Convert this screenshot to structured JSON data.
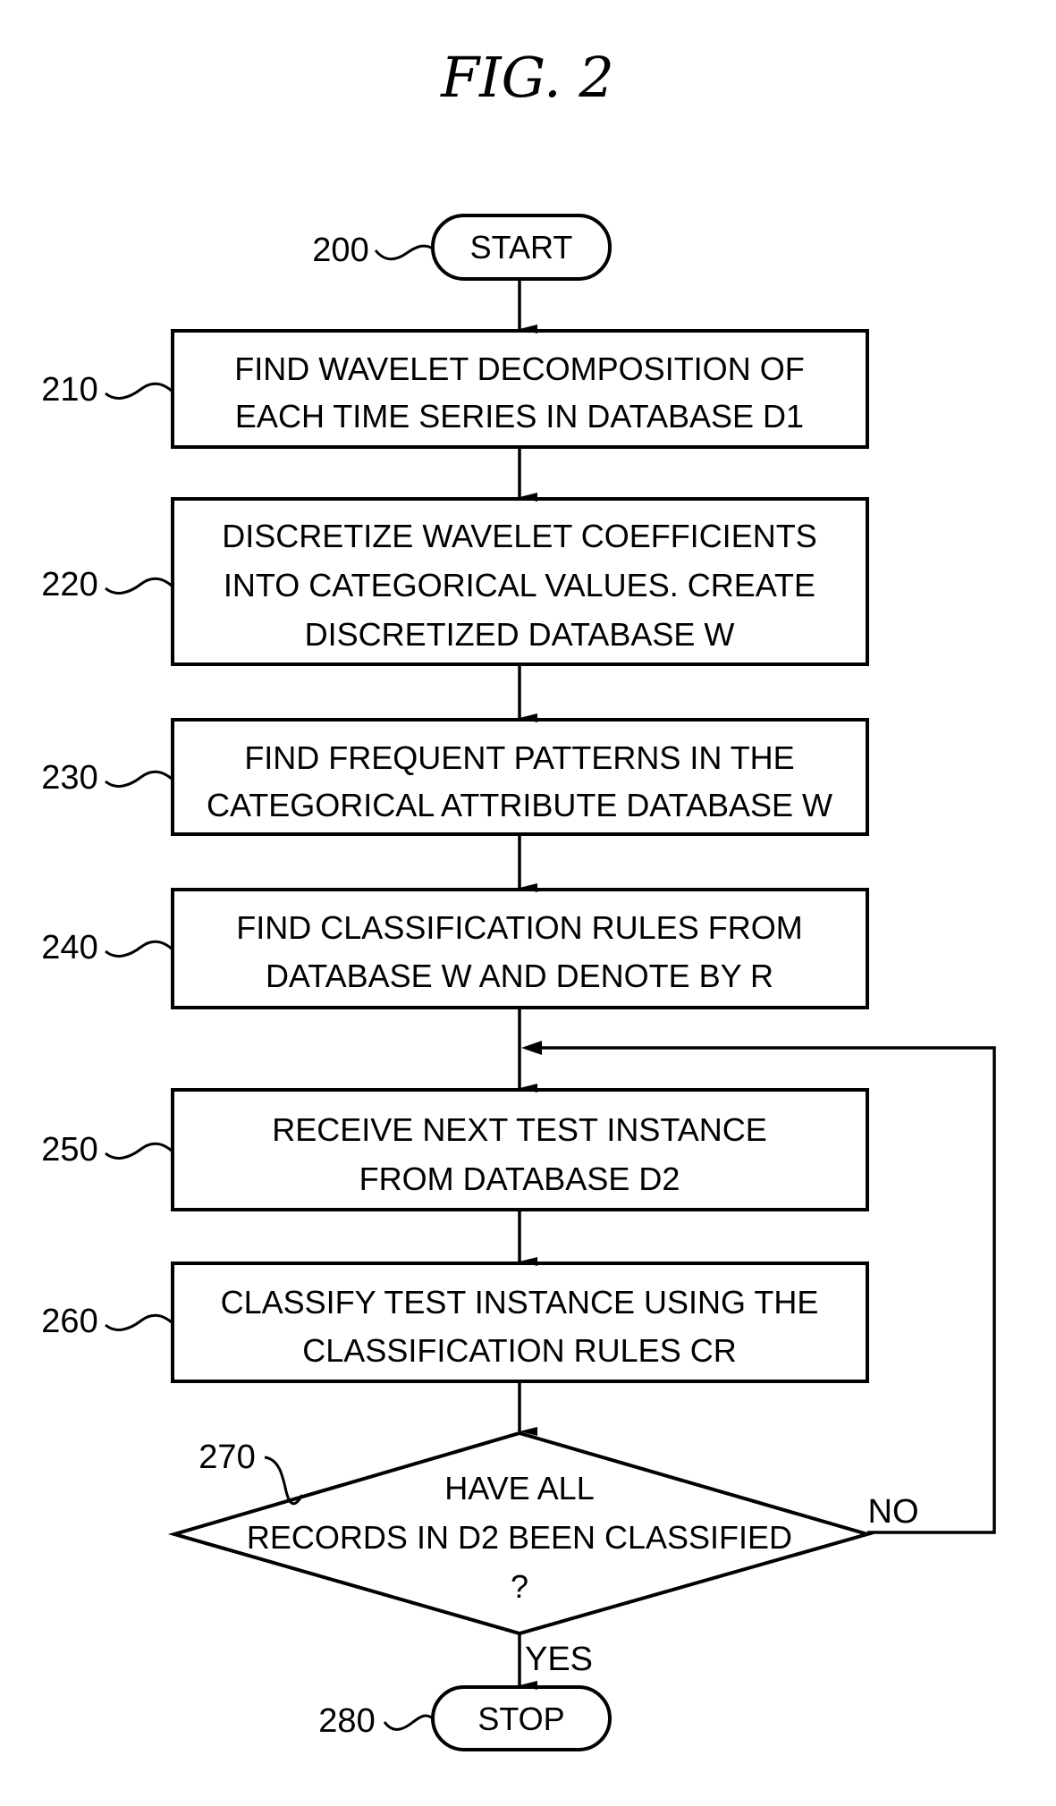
{
  "figure": {
    "title": "FIG. 2"
  },
  "nodes": [
    {
      "id": "200",
      "type": "terminal",
      "lines": [
        "START"
      ]
    },
    {
      "id": "210",
      "type": "process",
      "lines": [
        "FIND WAVELET DECOMPOSITION OF",
        "EACH TIME SERIES IN DATABASE D1"
      ]
    },
    {
      "id": "220",
      "type": "process",
      "lines": [
        "DISCRETIZE WAVELET COEFFICIENTS",
        "INTO CATEGORICAL VALUES. CREATE",
        "DISCRETIZED DATABASE W"
      ]
    },
    {
      "id": "230",
      "type": "process",
      "lines": [
        "FIND FREQUENT PATTERNS IN THE",
        "CATEGORICAL ATTRIBUTE DATABASE W"
      ]
    },
    {
      "id": "240",
      "type": "process",
      "lines": [
        "FIND CLASSIFICATION RULES FROM",
        "DATABASE W AND DENOTE BY R"
      ]
    },
    {
      "id": "250",
      "type": "process",
      "lines": [
        "RECEIVE NEXT TEST INSTANCE",
        "FROM DATABASE D2"
      ]
    },
    {
      "id": "260",
      "type": "process",
      "lines": [
        "CLASSIFY TEST INSTANCE USING THE",
        "CLASSIFICATION RULES CR"
      ]
    },
    {
      "id": "270",
      "type": "decision",
      "lines": [
        "HAVE ALL",
        "RECORDS IN D2 BEEN CLASSIFIED",
        "?"
      ]
    },
    {
      "id": "280",
      "type": "terminal",
      "lines": [
        "STOP"
      ]
    }
  ],
  "edges": [
    {
      "from": "200",
      "to": "210"
    },
    {
      "from": "210",
      "to": "220"
    },
    {
      "from": "220",
      "to": "230"
    },
    {
      "from": "230",
      "to": "240"
    },
    {
      "from": "240",
      "to": "250"
    },
    {
      "from": "250",
      "to": "260"
    },
    {
      "from": "260",
      "to": "270"
    },
    {
      "from": "270",
      "to": "250",
      "label": "NO"
    },
    {
      "from": "270",
      "to": "280",
      "label": "YES"
    }
  ],
  "branch_labels": {
    "no": "NO",
    "yes": "YES"
  }
}
